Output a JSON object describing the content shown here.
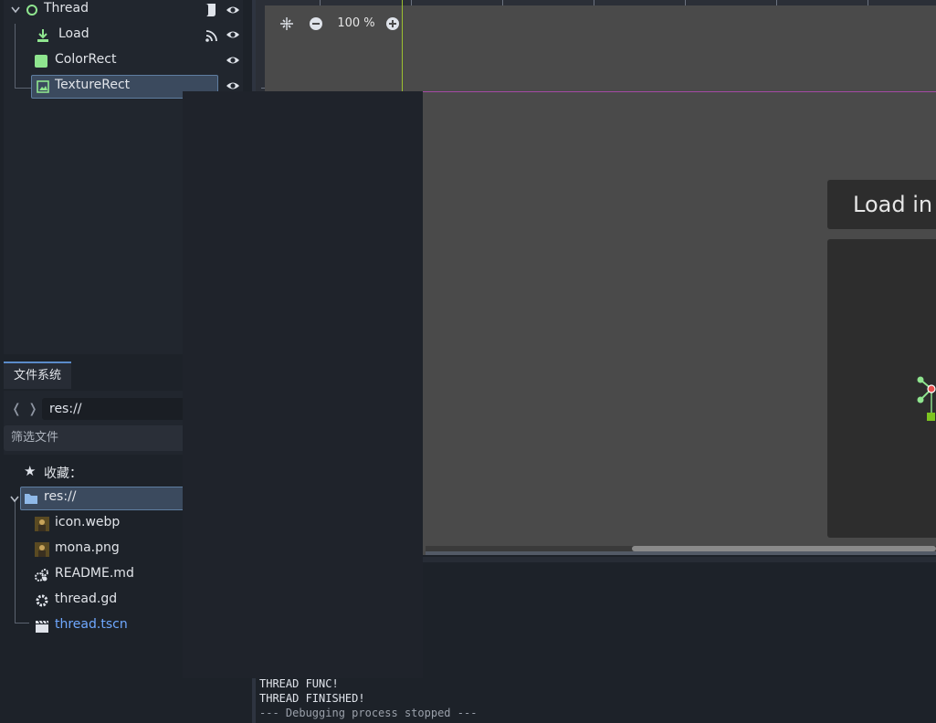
{
  "scene_tree": {
    "nodes": [
      {
        "label": "Thread",
        "icon": "node-circle-icon",
        "color": "#8fe58f"
      },
      {
        "label": "Load",
        "icon": "download-icon",
        "color": "#8fe58f"
      },
      {
        "label": "ColorRect",
        "icon": "color-rect-icon",
        "color": "#8fe58f"
      },
      {
        "label": "TextureRect",
        "icon": "texture-rect-icon",
        "color": "#8fe58f"
      }
    ]
  },
  "filesystem": {
    "tab_label": "文件系统",
    "path": "res://",
    "filter_placeholder": "筛选文件",
    "favorites_label": "收藏：",
    "root_label": "res://",
    "files": [
      {
        "name": "icon.webp",
        "icon": "image-thumb-icon"
      },
      {
        "name": "mona.png",
        "icon": "image-thumb-icon"
      },
      {
        "name": "README.md",
        "icon": "gear-cluster-icon"
      },
      {
        "name": "thread.gd",
        "icon": "gear-icon"
      },
      {
        "name": "thread.tscn",
        "icon": "clapperboard-icon",
        "color": "#6fa8ff"
      }
    ]
  },
  "viewport": {
    "zoom": "100 %",
    "panel_title": "Load in T"
  },
  "output": {
    "lines": [
      "THREAD FUNC!",
      "THREAD FINISHED!",
      "--- Debugging process stopped ---"
    ]
  },
  "colors": {
    "accent": "#5b8bc9",
    "selection": "#3b4a5e",
    "node_green": "#8fe58f",
    "guide_green": "#9cc02f",
    "guide_purple": "#a54aa4"
  }
}
